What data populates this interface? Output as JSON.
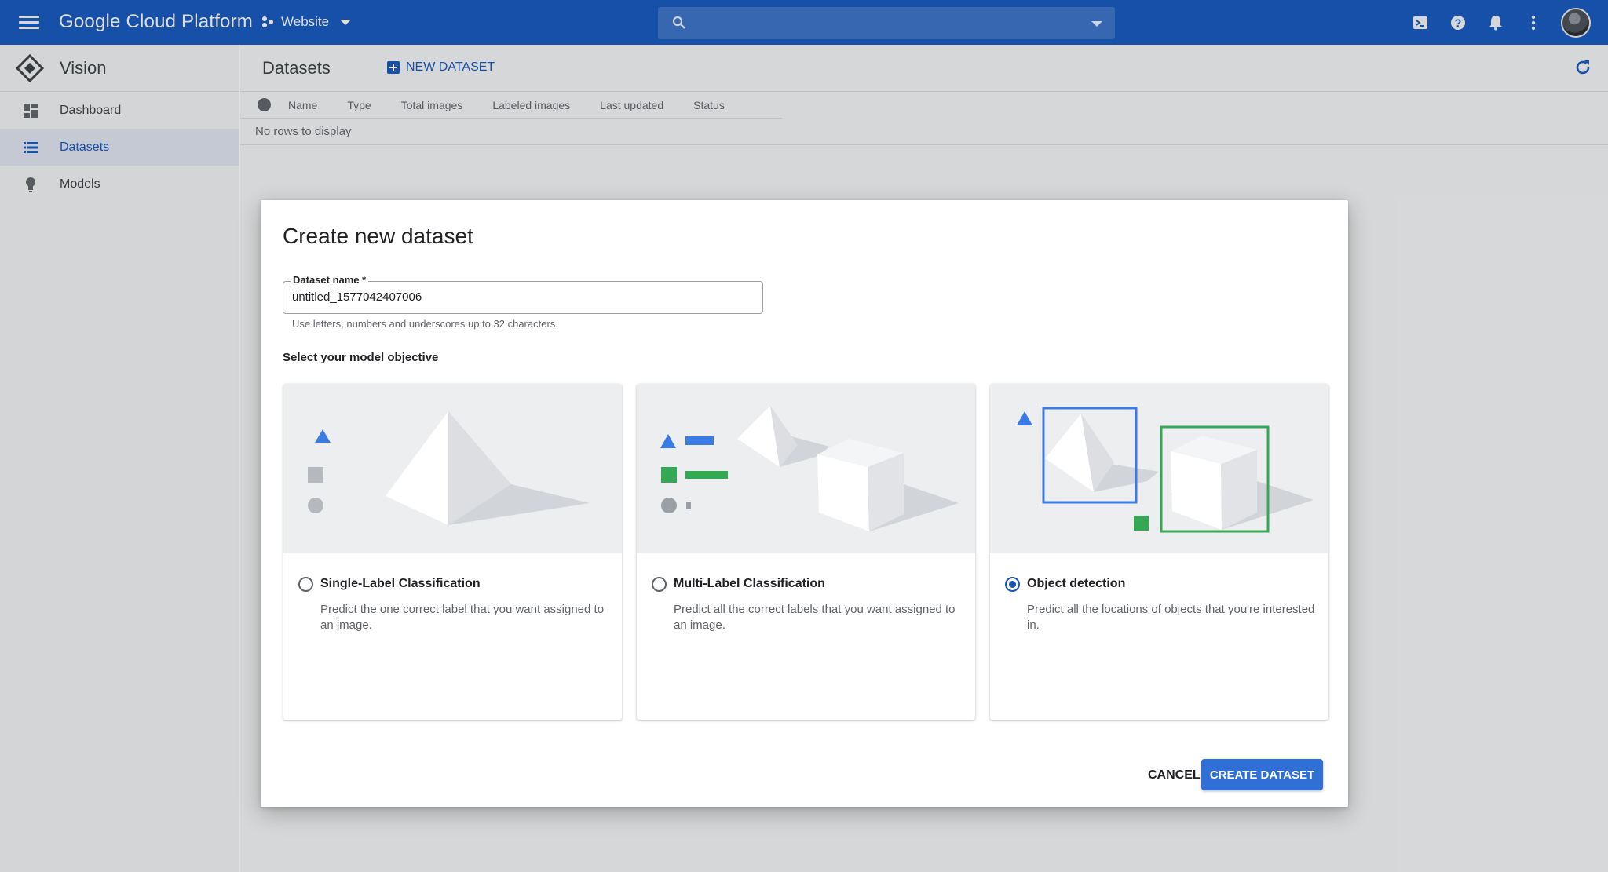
{
  "topbar": {
    "brand": "Google Cloud Platform",
    "project": "Website",
    "icons": [
      "menu-icon",
      "project-icon",
      "search-icon",
      "cloud-shell-icon",
      "help-icon",
      "notifications-icon",
      "more-vert-icon",
      "avatar"
    ]
  },
  "sidebar": {
    "title": "Vision",
    "items": [
      {
        "label": "Dashboard",
        "icon": "dashboard-icon"
      },
      {
        "label": "Datasets",
        "icon": "list-icon",
        "active": true
      },
      {
        "label": "Models",
        "icon": "lightbulb-icon"
      }
    ]
  },
  "main": {
    "title": "Datasets",
    "new_dataset": "NEW DATASET",
    "columns": [
      "Name",
      "Type",
      "Total images",
      "Labeled images",
      "Last updated",
      "Status"
    ],
    "empty_text": "No rows to display"
  },
  "dialog": {
    "title": "Create new dataset",
    "field_label": "Dataset name *",
    "field_value": "untitled_1577042407006",
    "field_hint": "Use letters, numbers and underscores up to 32 characters.",
    "objective_label": "Select your model objective",
    "cards": [
      {
        "title": "Single-Label Classification",
        "desc": "Predict the one correct label that you want assigned to an image.",
        "selected": false
      },
      {
        "title": "Multi-Label Classification",
        "desc": "Predict all the correct labels that you want assigned to an image.",
        "selected": false
      },
      {
        "title": "Object detection",
        "desc": "Predict all the locations of objects that you're interested in.",
        "selected": true
      }
    ],
    "cancel": "CANCEL",
    "create": "CREATE DATASET"
  },
  "colors": {
    "topbar": "#1a57b8",
    "primary": "#2f6fd6",
    "accent_blue": "#3b7be6",
    "accent_green": "#34a853"
  }
}
